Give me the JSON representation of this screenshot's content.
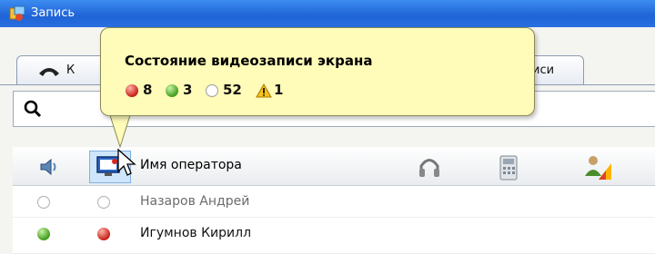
{
  "window": {
    "title": "Запись"
  },
  "tabs": [
    {
      "label": "К",
      "icon": "phone-handset-icon"
    },
    {
      "label": "иси"
    }
  ],
  "search": {
    "icon": "search-icon",
    "value": ""
  },
  "grid": {
    "columns": {
      "sound": "speaker-icon",
      "screen": "monitor-icon",
      "name": "Имя оператора",
      "audio": "headset-icon",
      "phone": "phone-icon",
      "agent": "agent-icon"
    },
    "rows": [
      {
        "sound_status": "empty",
        "screen_status": "empty",
        "name": "Назаров Андрей"
      },
      {
        "sound_status": "green",
        "screen_status": "red",
        "name": "Игумнов Кирилл"
      }
    ]
  },
  "tooltip": {
    "title": "Состояние видеозаписи экрана",
    "stats": [
      {
        "status": "red",
        "count": "8"
      },
      {
        "status": "green",
        "count": "3"
      },
      {
        "status": "empty",
        "count": "52"
      },
      {
        "status": "warning",
        "count": "1"
      }
    ]
  },
  "colors": {
    "titlebar": "#2a6fe0",
    "tooltip_bg": "#fffbb8",
    "red": "#d9261c",
    "green": "#4caf24",
    "warning": "#f0b400"
  }
}
